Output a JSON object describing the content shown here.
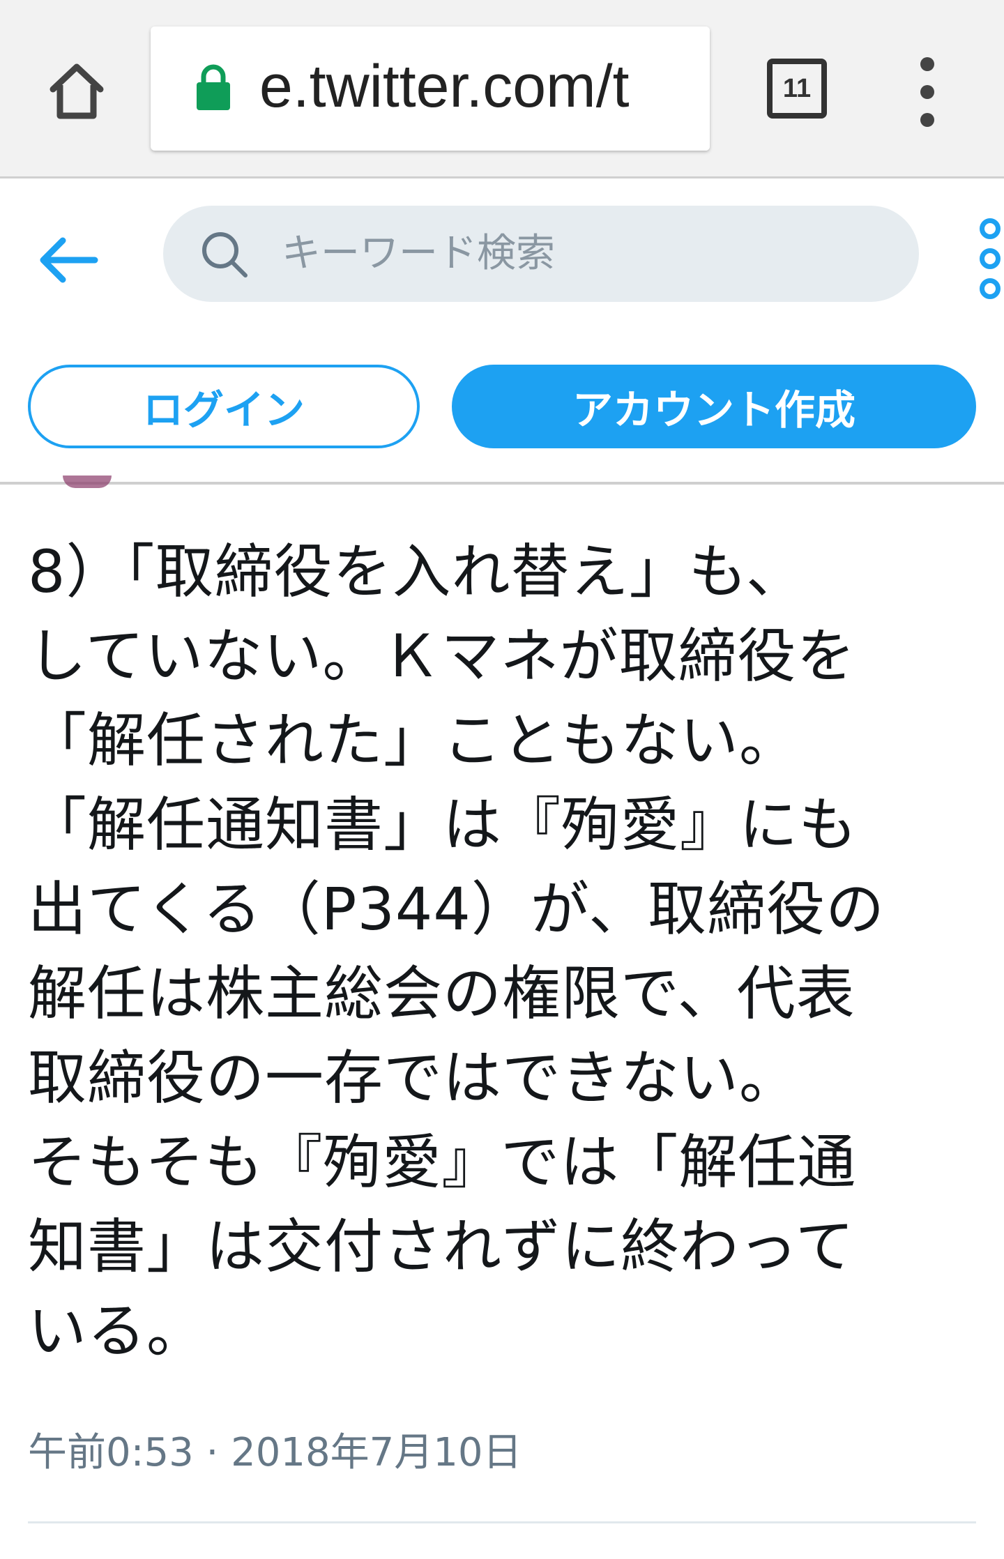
{
  "browser": {
    "home_icon": "home-icon",
    "lock_icon": "lock-icon",
    "lock_color": "#0f9d58",
    "url": "e.twitter.com/t",
    "tab_count": "11",
    "menu_icon": "vertical-dots-icon"
  },
  "header": {
    "back_icon": "arrow-left-icon",
    "search_icon": "search-icon",
    "search_placeholder": "キーワード検索",
    "more_icon": "more-icon",
    "login_label": "ログイン",
    "signup_label": "アカウント作成",
    "accent_color": "#1da1f2"
  },
  "tweet": {
    "text": "8）「取締役を入れ替え」も、\nしていない。Ｋマネが取締役を\n「解任された」こともない。\n「解任通知書」は『殉愛』にも\n出てくる（P344）が、取締役の\n解任は株主総会の権限で、代表\n取締役の一存ではできない。\nそもそも『殉愛』では「解任通\n知書」は交付されずに終わって\nいる。",
    "timestamp": "午前0:53 · 2018年7月10日"
  }
}
